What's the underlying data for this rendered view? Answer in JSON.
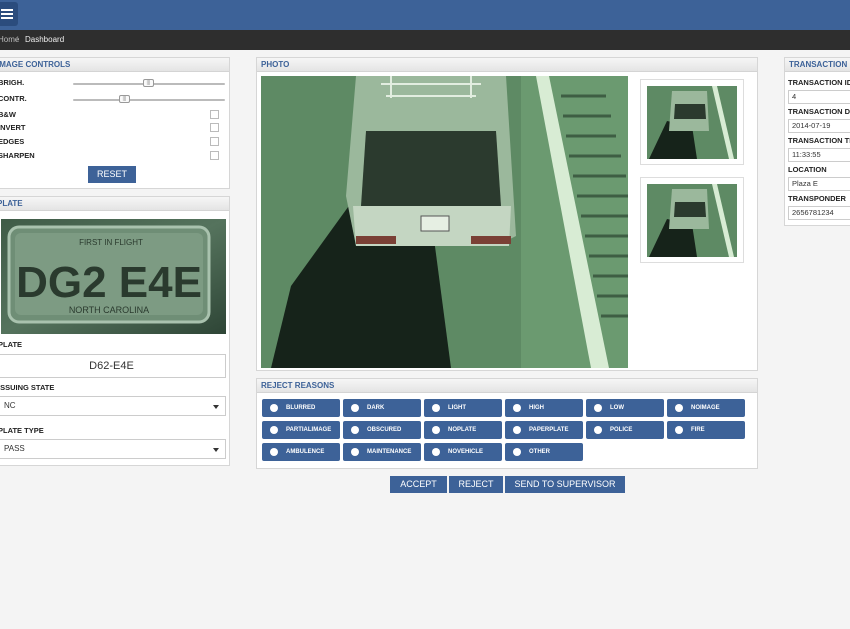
{
  "header": {
    "menu_icon": "hamburger-icon"
  },
  "breadcrumb": {
    "home": "Home",
    "separator": "/",
    "current": "Dashboard"
  },
  "image_controls": {
    "title": "IMAGE CONTROLS",
    "brightness_label": "BRIGH.",
    "brightness_level": 0.5,
    "contrast_label": "CONTR.",
    "contrast_level": 0.33,
    "bw_label": "B&W",
    "invert_label": "INVERT",
    "edges_label": "EDGES",
    "sharpen_label": "SHARPEN",
    "reset_label": "RESET"
  },
  "plate_panel": {
    "title": "PLATE",
    "crop_text": "DG2 E4E",
    "crop_top_text": "FIRST IN FLIGHT",
    "crop_bottom_text": "NORTH CAROLINA",
    "plate_label": "PLATE",
    "plate_value": "D62-E4E",
    "state_label": "ISSUING STATE",
    "state_value": "NC",
    "type_label": "PLATE TYPE",
    "type_value": "PASS"
  },
  "photo": {
    "title": "PHOTO"
  },
  "reject_reasons": {
    "title": "REJECT REASONS",
    "items": [
      "BLURRED",
      "DARK",
      "LIGHT",
      "HIGH",
      "LOW",
      "NOIMAGE",
      "PARTIALIMAGE",
      "OBSCURED",
      "NOPLATE",
      "PAPERPLATE",
      "POLICE",
      "FIRE",
      "AMBULENCE",
      "MAINTENANCE",
      "NOVEHICLE",
      "OTHER"
    ]
  },
  "actions": {
    "accept": "ACCEPT",
    "reject": "REJECT",
    "supervisor": "SEND TO SUPERVISOR"
  },
  "transaction": {
    "title": "TRANSACTION INFO",
    "id_label": "TRANSACTION ID",
    "id_value": "4",
    "date_label": "TRANSACTION DATE",
    "date_value": "2014-07-19",
    "time_label": "TRANSACTION TIME",
    "time_value": "11:33:55",
    "location_label": "LOCATION",
    "location_value": "Plaza E",
    "transponder_label": "TRANSPONDER",
    "transponder_value": "2656781234"
  },
  "colors": {
    "brand": "#3d6298",
    "breadcrumb_bg": "#2e2e2e",
    "photo_tint": "#5f8a66"
  }
}
